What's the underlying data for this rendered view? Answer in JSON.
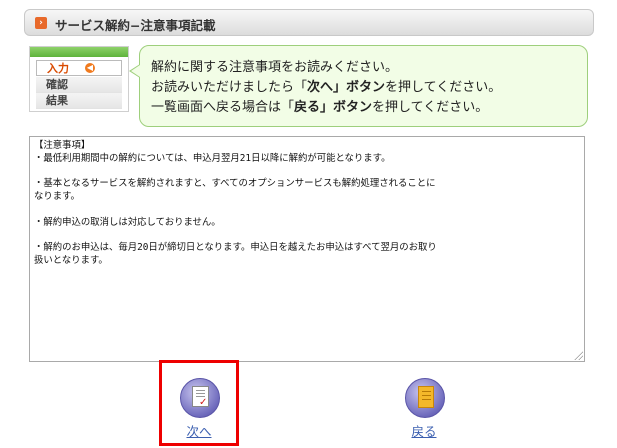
{
  "header": {
    "title": "サービス解約−注意事項記載",
    "icon": "orange-arrow-icon"
  },
  "steps": {
    "items": [
      {
        "label": "入力",
        "active": true
      },
      {
        "label": "確認",
        "active": false
      },
      {
        "label": "結果",
        "active": false
      }
    ]
  },
  "info": {
    "line1": "解約に関する注意事項をお読みください。",
    "line2_pre": "お読みいただけましたら「",
    "line2_bold": "次へ」ボタン",
    "line2_post": "を押してください。",
    "line3_pre": "一覧画面へ戻る場合は「",
    "line3_bold": "戻る」ボタン",
    "line3_post": "を押してください。"
  },
  "notes": {
    "text": "【注意事項】\n・最低利用期間中の解約については、申込月翌月21日以降に解約が可能となります。\n\n・基本となるサービスを解約されますと、すべてのオプションサービスも解約処理されることに\nなります。\n\n・解約申込の取消しは対応しておりません。\n\n・解約のお申込は、毎月20日が締切日となります。申込日を越えたお申込はすべて翌月のお取り\n扱いとなります。"
  },
  "buttons": {
    "next_label": "次へ",
    "back_label": "戻る"
  },
  "colors": {
    "accent_orange": "#e8692a",
    "bubble_bg": "#f2fde6",
    "bubble_border": "#9ecf7c",
    "link_blue": "#3b5fb0",
    "highlight_red": "#ee0000"
  }
}
